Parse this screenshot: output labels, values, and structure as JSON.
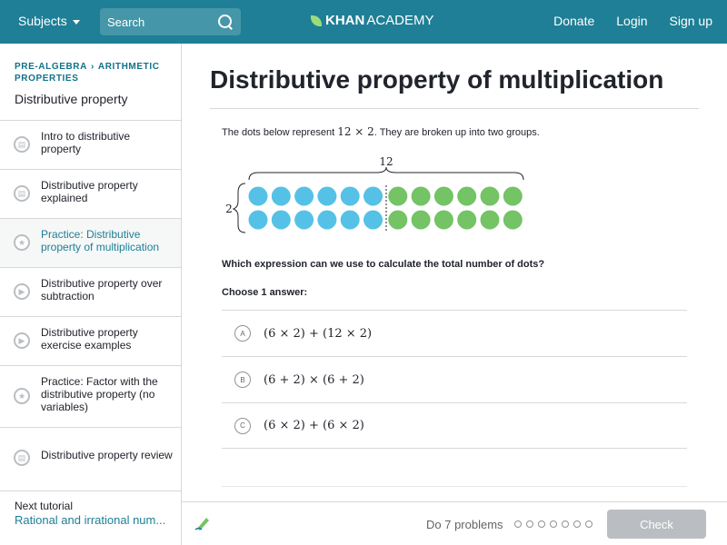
{
  "header": {
    "subjects_label": "Subjects",
    "search_placeholder": "Search",
    "logo_bold": "KHAN",
    "logo_rest": "ACADEMY",
    "links": [
      "Donate",
      "Login",
      "Sign up"
    ]
  },
  "sidebar": {
    "breadcrumb": [
      "PRE-ALGEBRA",
      "ARITHMETIC PROPERTIES"
    ],
    "title": "Distributive property",
    "items": [
      {
        "label": "Intro to distributive property",
        "icon": "document-icon"
      },
      {
        "label": "Distributive property explained",
        "icon": "document-icon"
      },
      {
        "label": "Practice: Distributive property of multiplication",
        "icon": "star-icon",
        "active": true
      },
      {
        "label": "Distributive property over subtraction",
        "icon": "play-icon"
      },
      {
        "label": "Distributive property exercise examples",
        "icon": "play-icon"
      },
      {
        "label": "Practice: Factor with the distributive property (no variables)",
        "icon": "star-icon"
      },
      {
        "label": "Distributive property review",
        "icon": "document-icon"
      }
    ],
    "next_label": "Next tutorial",
    "next_value": "Rational and irrational num..."
  },
  "main": {
    "title": "Distributive property of multiplication",
    "intro_before": "The dots below represent ",
    "intro_math": "12 × 2",
    "intro_after": ". They are broken up into two groups.",
    "figure": {
      "top_label": "12",
      "side_label": "2",
      "rows": 2,
      "blue_per_row": 6,
      "green_per_row": 6,
      "blue_color": "#55c1e7",
      "green_color": "#74c365"
    },
    "question": "Which expression can we use to calculate the total number of dots?",
    "choose": "Choose 1 answer:",
    "choices": [
      {
        "letter": "A",
        "expr": "(6 × 2) + (12 × 2)"
      },
      {
        "letter": "B",
        "expr": "(6 + 2) × (6 + 2)"
      },
      {
        "letter": "C",
        "expr": "(6 × 2) + (6 × 2)"
      }
    ]
  },
  "footer": {
    "do_problems": "Do 7 problems",
    "problem_count": 7,
    "check_label": "Check"
  },
  "colors": {
    "header_bg": "#1e7f96",
    "link": "#1d7f96",
    "check_disabled": "#babec2"
  }
}
